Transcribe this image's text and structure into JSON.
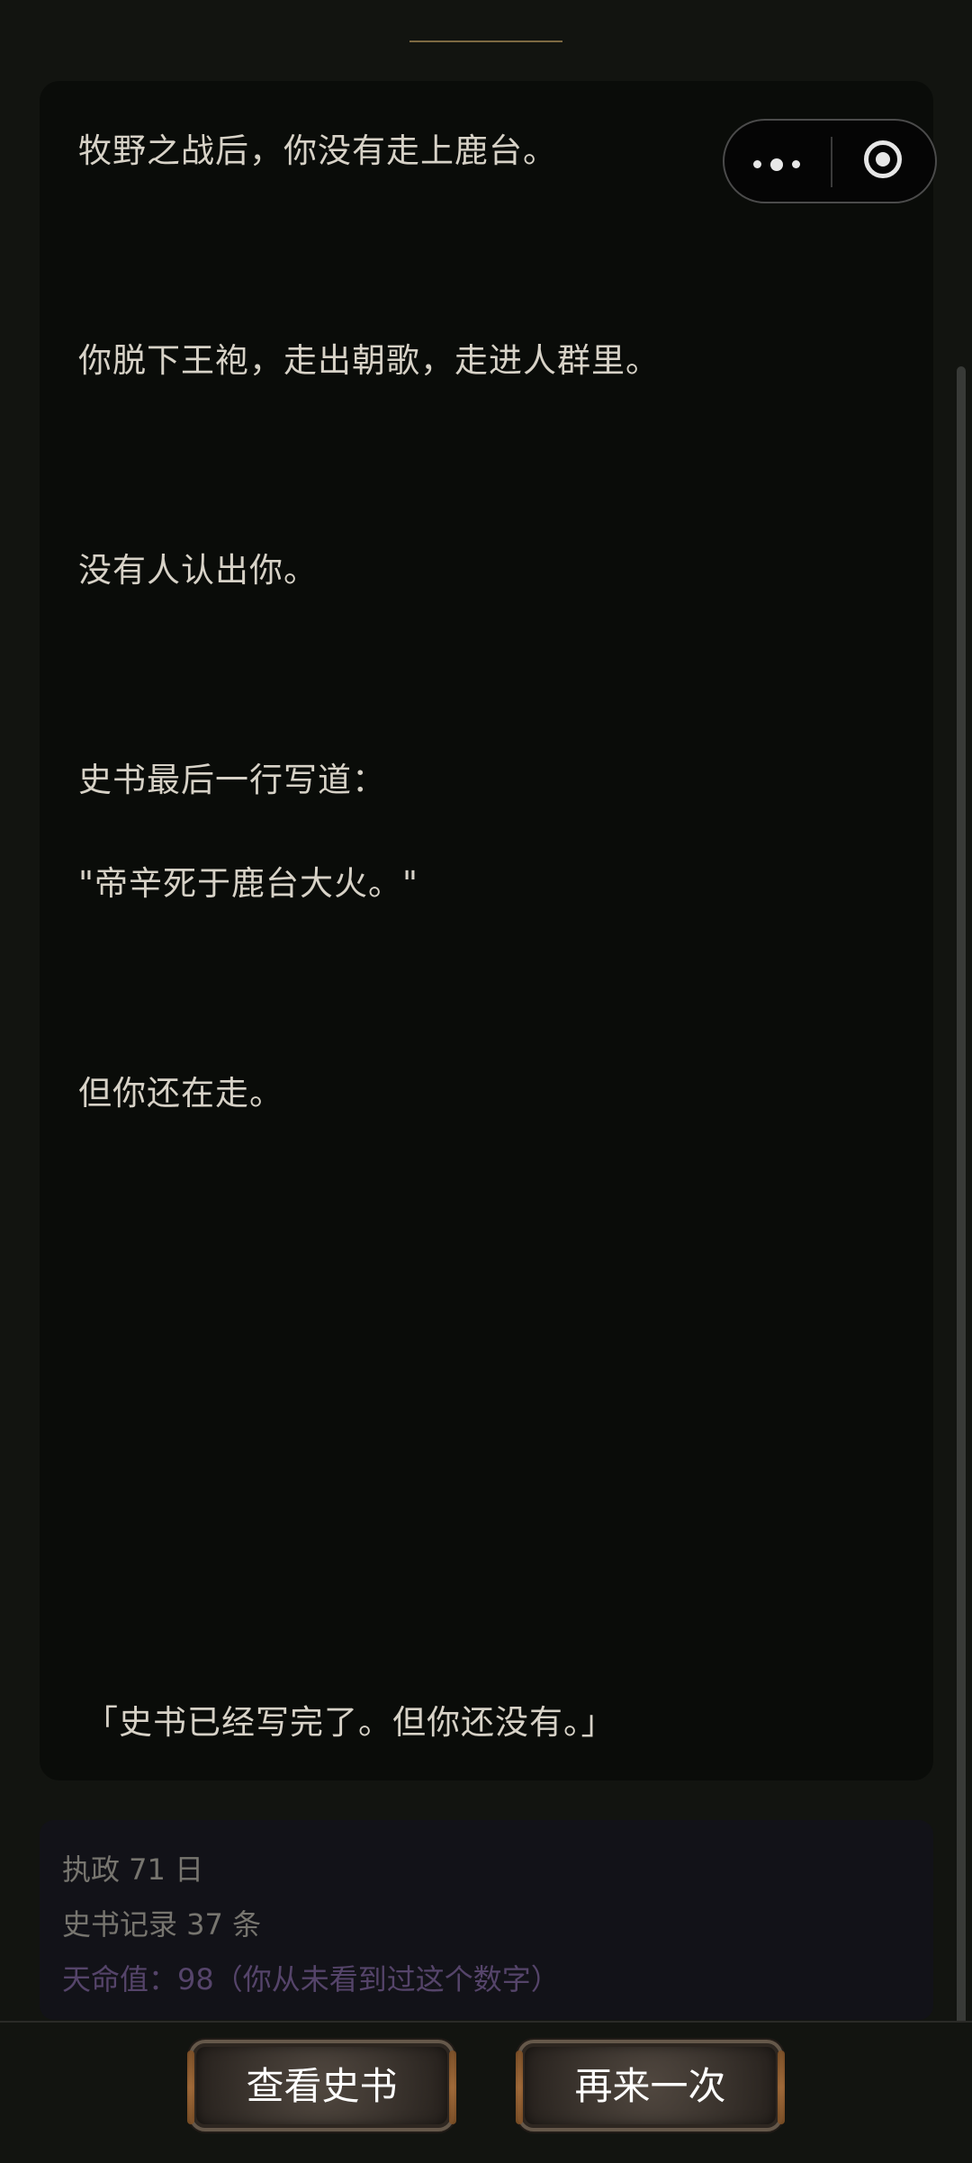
{
  "story": {
    "lines": [
      "牧野之战后，你没有走上鹿台。",
      "你脱下王袍，走出朝歌，走进人群里。",
      "没有人认出你。",
      "史书最后一行写道：",
      "\"帝辛死于鹿台大火。\"",
      "但你还在走。",
      "「史书已经写完了。但你还没有。」"
    ]
  },
  "capsule": {
    "more_icon": "more-icon",
    "close_icon": "close-icon"
  },
  "stats": {
    "rule": "执政 71 日",
    "records": "史书记录 37 条",
    "fate": "天命值：98（你从未看到过这个数字）"
  },
  "buttons": {
    "view_history": "查看史书",
    "retry": "再来一次"
  },
  "colors": {
    "background": "#121410",
    "card": "#0a0c09",
    "text": "#d7d2c7",
    "muted": "#77756f",
    "fate": "#55446a",
    "button_text": "#ffffff"
  }
}
